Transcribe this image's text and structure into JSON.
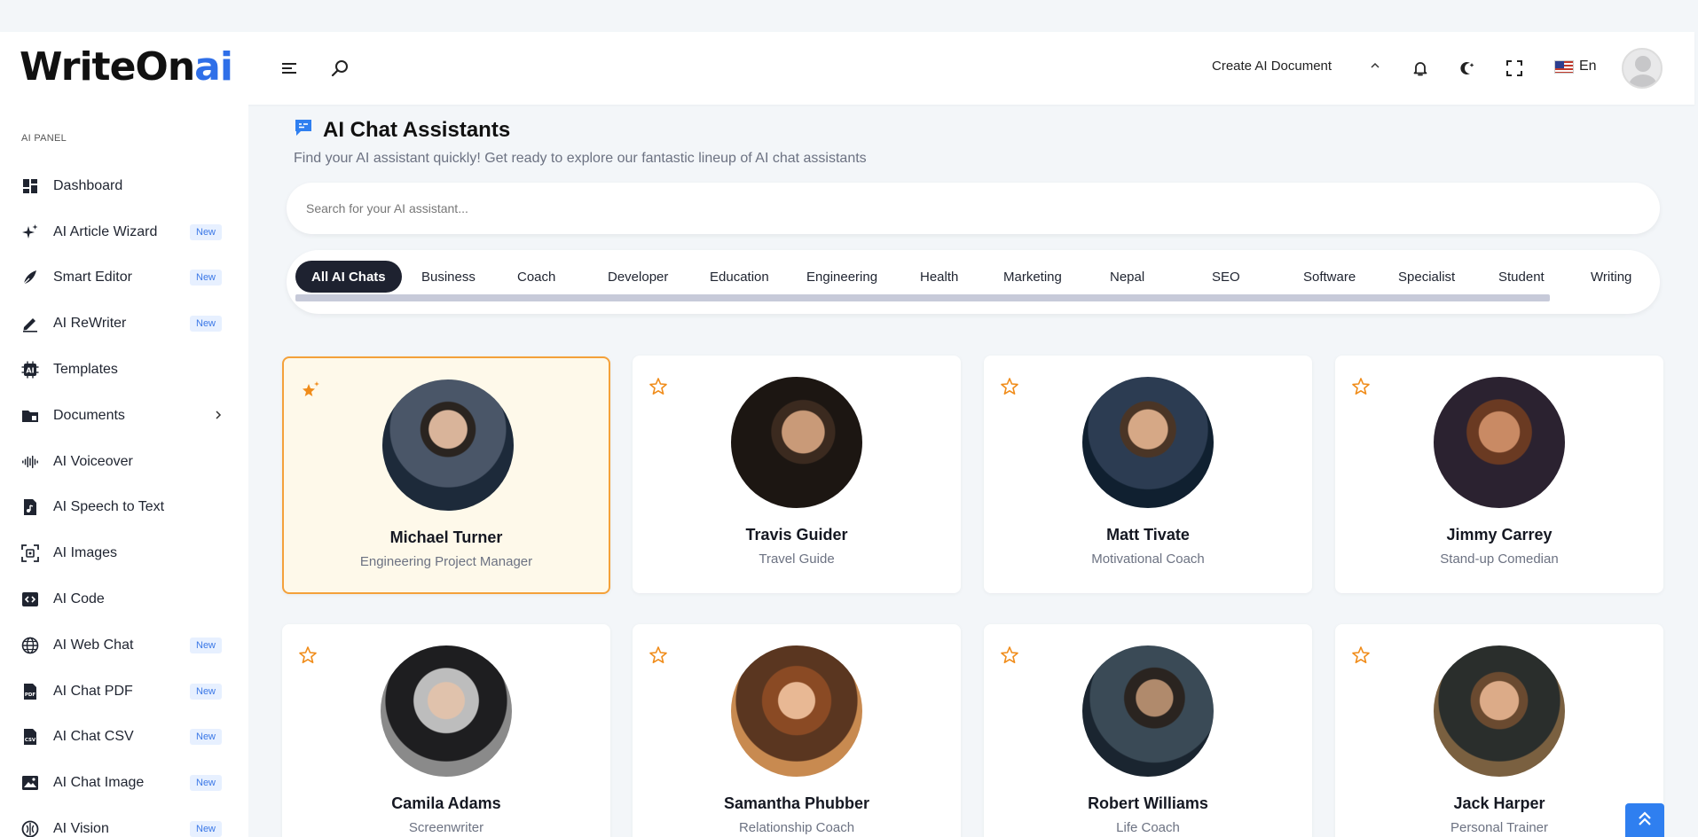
{
  "brand": {
    "logo_main": "WriteOn",
    "logo_accent": "ai"
  },
  "header": {
    "create_doc": "Create AI Document",
    "lang": "En"
  },
  "sidebar": {
    "panel_title": "AI PANEL",
    "items": [
      {
        "label": "Dashboard",
        "icon": "dashboard-icon",
        "badge": ""
      },
      {
        "label": "AI Article Wizard",
        "icon": "sparkle-icon",
        "badge": "New"
      },
      {
        "label": "Smart Editor",
        "icon": "pen-nib-icon",
        "badge": "New"
      },
      {
        "label": "AI ReWriter",
        "icon": "pencil-icon",
        "badge": "New"
      },
      {
        "label": "Templates",
        "icon": "ai-chip-icon",
        "badge": ""
      },
      {
        "label": "Documents",
        "icon": "folder-icon",
        "badge": ""
      },
      {
        "label": "AI Voiceover",
        "icon": "waveform-icon",
        "badge": ""
      },
      {
        "label": "AI Speech to Text",
        "icon": "music-file-icon",
        "badge": ""
      },
      {
        "label": "AI Images",
        "icon": "image-scan-icon",
        "badge": ""
      },
      {
        "label": "AI Code",
        "icon": "code-icon",
        "badge": ""
      },
      {
        "label": "AI Web Chat",
        "icon": "globe-icon",
        "badge": "New"
      },
      {
        "label": "AI Chat PDF",
        "icon": "pdf-icon",
        "badge": "New"
      },
      {
        "label": "AI Chat CSV",
        "icon": "csv-icon",
        "badge": "New"
      },
      {
        "label": "AI Chat Image",
        "icon": "picture-icon",
        "badge": "New"
      },
      {
        "label": "AI Vision",
        "icon": "brain-icon",
        "badge": "New"
      }
    ]
  },
  "main": {
    "title": "AI Chat Assistants",
    "subtitle": "Find your AI assistant quickly! Get ready to explore our fantastic lineup of AI chat assistants",
    "search_placeholder": "Search for your AI assistant...",
    "categories": [
      "All AI Chats",
      "Business",
      "Coach",
      "Developer",
      "Education",
      "Engineering",
      "Health",
      "Marketing",
      "Nepal",
      "SEO",
      "Software",
      "Specialist",
      "Student",
      "Writing"
    ],
    "active_category": "All AI Chats",
    "assistants": [
      {
        "name": "Michael Turner",
        "role": "Engineering Project Manager",
        "featured": true
      },
      {
        "name": "Travis Guider",
        "role": "Travel Guide",
        "featured": false
      },
      {
        "name": "Matt Tivate",
        "role": "Motivational Coach",
        "featured": false
      },
      {
        "name": "Jimmy Carrey",
        "role": "Stand-up Comedian",
        "featured": false
      },
      {
        "name": "Camila Adams",
        "role": "Screenwriter",
        "featured": false
      },
      {
        "name": "Samantha Phubber",
        "role": "Relationship Coach",
        "featured": false
      },
      {
        "name": "Robert Williams",
        "role": "Life Coach",
        "featured": false
      },
      {
        "name": "Jack Harper",
        "role": "Personal Trainer",
        "featured": false
      }
    ]
  },
  "colors": {
    "accent": "#2f6fe8",
    "star": "#f08c1a",
    "featured_bg": "#fef9ea",
    "featured_border": "#f4a13a",
    "dark_pill": "#1e2230"
  }
}
